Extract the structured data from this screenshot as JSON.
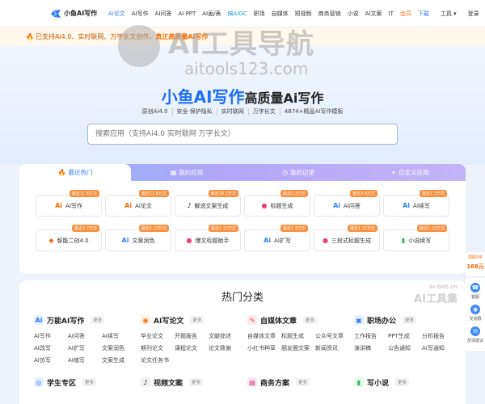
{
  "nav": {
    "logo_text": "小鱼AI写作",
    "items": [
      {
        "label": "Ai论文",
        "style": "active"
      },
      {
        "label": "AI写作",
        "style": ""
      },
      {
        "label": "AI问答",
        "style": ""
      },
      {
        "label": "AI PPT",
        "style": ""
      },
      {
        "label": "AI画/表",
        "style": ""
      },
      {
        "label": "搞AIGC",
        "style": "cyan"
      },
      {
        "label": "职场",
        "style": ""
      },
      {
        "label": "自媒体",
        "style": ""
      },
      {
        "label": "短视频",
        "style": ""
      },
      {
        "label": "商务营销",
        "style": ""
      },
      {
        "label": "小说",
        "style": ""
      },
      {
        "label": "AI文案",
        "style": ""
      },
      {
        "label": "IT",
        "style": ""
      },
      {
        "label": "会员",
        "style": "orange"
      },
      {
        "label": "下载",
        "style": "blue"
      }
    ],
    "member_badge": "限时优惠14.8",
    "tools_label": "工具 ▾",
    "login_label": "登录"
  },
  "notice": {
    "icon": "🔥",
    "text_prefix": "已支持Ai4.0、实时联网、万字长文创作，",
    "text_highlight": "真正高质量Ai写作"
  },
  "watermark": {
    "title": "AI工具导航",
    "url": "aitools123.com"
  },
  "hero": {
    "brand": "小鱼AI写作",
    "subtitle": "高质量Ai写作",
    "tags": [
      "原创Ai4.0",
      "安全·保护隐私",
      "实时联网",
      "万字长文",
      "4874+精品AI写作模板"
    ],
    "search_placeholder": "搜索应用（支持Ai4.0 实时联网 万字长文）"
  },
  "tabs": [
    {
      "icon": "🔥",
      "label": "最近热门"
    },
    {
      "icon": "▦",
      "label": "我的应用"
    },
    {
      "icon": "◷",
      "label": "我的记录"
    },
    {
      "icon": "+",
      "label": "自定义应用"
    }
  ],
  "apps": [
    {
      "icon": "Ai",
      "label": "AI写作",
      "badge": "最近11.6万次",
      "color": "#ff6a00"
    },
    {
      "icon": "Ai",
      "label": "Ai论文",
      "badge": "最近11.6万次",
      "color": "#ff6a00"
    },
    {
      "icon": "♪",
      "label": "解说文案生成",
      "badge": "最近16.2万次",
      "color": "#111111"
    },
    {
      "icon": "●",
      "label": "标题生成",
      "badge": "最近2.2万次",
      "color": "#f04070"
    },
    {
      "icon": "Ai",
      "label": "AI问答",
      "badge": "最近2.4万次",
      "color": "#2e7cf6"
    },
    {
      "icon": "Ai",
      "label": "AI续写",
      "badge": "最近2.2万次",
      "color": "#2e7cf6"
    },
    {
      "icon": "◆",
      "label": "智能二创4.0",
      "badge": "最近2.7万次",
      "color": "#ff6a00"
    },
    {
      "icon": "Ai",
      "label": "文案润色",
      "badge": "最近1.12万次",
      "color": "#2e7cf6"
    },
    {
      "icon": "●",
      "label": "爆文标题助手",
      "badge": "最近1.12万次",
      "color": "#f04070"
    },
    {
      "icon": "Ai",
      "label": "AI扩写",
      "badge": "最近1.4万次",
      "color": "#2e7cf6"
    },
    {
      "icon": "●",
      "label": "三段式标题生成",
      "badge": "最近1.12万次",
      "color": "#f04070"
    },
    {
      "icon": "▮",
      "label": "小说续写",
      "badge": "最近1.12万次",
      "color": "#2db55d"
    }
  ],
  "section": {
    "title": "热门分类",
    "watermark_url": "ai-bot.cn",
    "watermark_title": "AI工具集",
    "more_label": "更多",
    "categories": [
      {
        "icon": "Ai",
        "icon_color": "#2e7cf6",
        "icon_bg": "#e8f0fe",
        "name": "万能AI写作",
        "items": [
          "AI写作",
          "AI问答",
          "AI续写",
          "AI改写",
          "AI扩写",
          "文案润色",
          "AI仿写",
          "AI缩写",
          "文案生成"
        ]
      },
      {
        "icon": "◉",
        "icon_color": "#ff6a00",
        "icon_bg": "#fff1e6",
        "name": "AI写论文",
        "items": [
          "毕业论文",
          "开题报告",
          "文献综述",
          "期刊论文",
          "课程论文",
          "论文致谢",
          "论文任务书"
        ]
      },
      {
        "icon": "✎",
        "icon_color": "#e53935",
        "icon_bg": "#fdeaea",
        "name": "自媒体文章",
        "items": [
          "自媒体文章",
          "标题生成",
          "公众号文章",
          "小红书种草",
          "朋友圈文案",
          "新闻资讯"
        ]
      },
      {
        "icon": "▣",
        "icon_color": "#2e7cf6",
        "icon_bg": "#e8f0fe",
        "name": "职场办公",
        "items": [
          "工作报告",
          "PPT生成",
          "分析报告",
          "演讲稿",
          "公告通知",
          "AI写通知"
        ]
      },
      {
        "icon": "◎",
        "icon_color": "#2e7cf6",
        "icon_bg": "#e8f0fe",
        "name": "学生专区",
        "items": []
      },
      {
        "icon": "♪",
        "icon_color": "#111111",
        "icon_bg": "#f0f0f0",
        "name": "视频文案",
        "items": []
      },
      {
        "icon": "▤",
        "icon_color": "#d63384",
        "icon_bg": "#fbe7f1",
        "name": "商务方案",
        "items": []
      },
      {
        "icon": "▮",
        "icon_color": "#2db55d",
        "icon_bg": "#e6f7ec",
        "name": "写小说",
        "items": []
      }
    ]
  },
  "side": {
    "vip_line1": "领取VIP",
    "vip_line2": "168元",
    "buttons": [
      {
        "icon": "☎",
        "label": "客服"
      },
      {
        "icon": "◉",
        "label": "交流群"
      },
      {
        "icon": "✉",
        "label": "反馈建议"
      }
    ]
  }
}
